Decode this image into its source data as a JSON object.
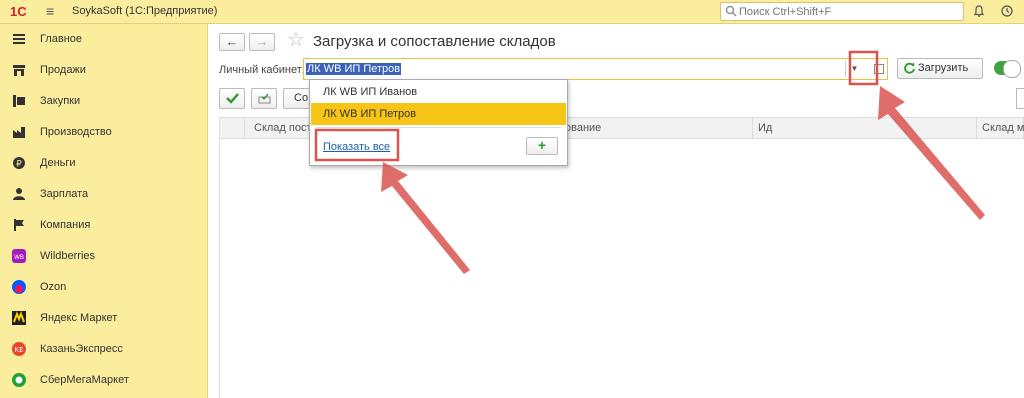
{
  "topbar": {
    "logo": "1С",
    "title": "SoykaSoft  (1С:Предприятие)",
    "search_placeholder": "Поиск Ctrl+Shift+F"
  },
  "sidebar": {
    "items": [
      {
        "label": "Главное",
        "icon": "menu-lines-icon"
      },
      {
        "label": "Продажи",
        "icon": "shop-icon"
      },
      {
        "label": "Закупки",
        "icon": "cart-icon"
      },
      {
        "label": "Производство",
        "icon": "factory-icon"
      },
      {
        "label": "Деньги",
        "icon": "ruble-icon"
      },
      {
        "label": "Зарплата",
        "icon": "person-icon"
      },
      {
        "label": "Компания",
        "icon": "flag-icon"
      },
      {
        "label": "Wildberries",
        "icon": "wildberries-icon"
      },
      {
        "label": "Ozon",
        "icon": "ozon-icon"
      },
      {
        "label": "Яндекс Маркет",
        "icon": "yandex-market-icon"
      },
      {
        "label": "КазаньЭкспресс",
        "icon": "kazanexpress-icon"
      },
      {
        "label": "СберМегаМаркет",
        "icon": "sbermegamarket-icon"
      }
    ]
  },
  "main": {
    "title": "Загрузка и сопоставление складов",
    "field_label": "Личный кабинет:",
    "field_value": "ЛК WB ИП Петров",
    "load_button": "Загрузить",
    "toolbar_partial": "Со",
    "columns": [
      "Склад пост",
      "ование",
      "Ид",
      "Склад м"
    ]
  },
  "dropdown": {
    "items": [
      "ЛК WB ИП Иванов",
      "ЛК WB ИП Петров"
    ],
    "selected_index": 1,
    "show_all": "Показать все",
    "add_label": "+"
  },
  "colors": {
    "accent_yellow": "#fbed9e",
    "selected_item": "#f6c516",
    "annotation_red": "#d9534f",
    "green": "#2e9a2e"
  }
}
